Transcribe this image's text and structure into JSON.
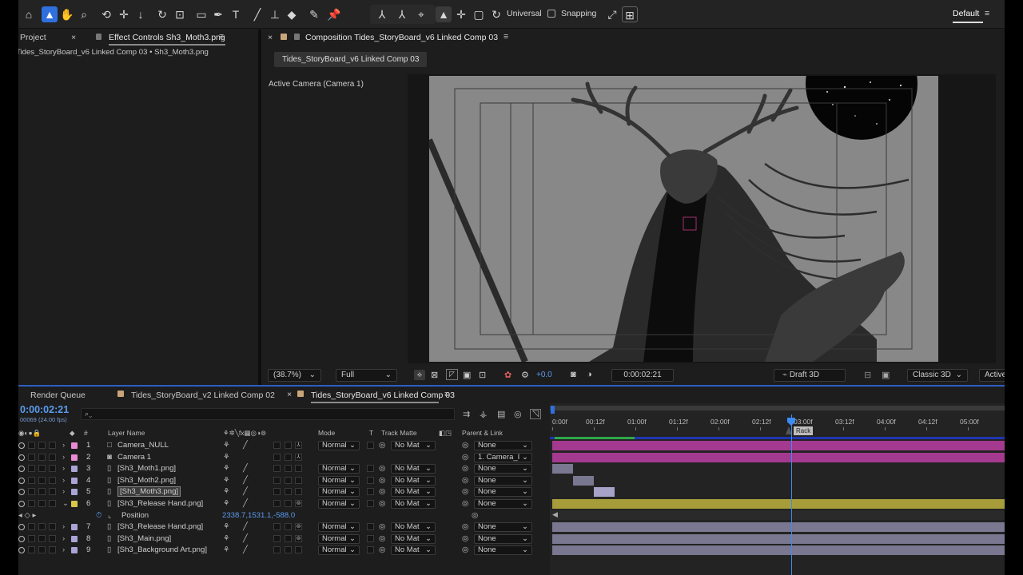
{
  "toolbar": {
    "universal_label": "Universal",
    "snapping_label": "Snapping",
    "workspace_label": "Default"
  },
  "left_panel": {
    "project_tab": "Project",
    "effect_tab": "Effect Controls Sh3_Moth3.png",
    "breadcrumb": "Tides_StoryBoard_v6 Linked Comp 03 • Sh3_Moth3.png"
  },
  "comp_panel": {
    "tab_label": "Composition Tides_StoryBoard_v6 Linked Comp 03",
    "comp_chip": "Tides_StoryBoard_v6 Linked Comp 03",
    "camera_label": "Active Camera (Camera 1)"
  },
  "viewer_status": {
    "zoom": "(38.7%)",
    "resolution": "Full",
    "exposure": "+0.0",
    "timecode": "0:00:02:21",
    "draft3d": "Draft 3D",
    "renderer": "Classic 3D",
    "active_camera": "Active Cam"
  },
  "timeline_tabs": {
    "render_queue": "Render Queue",
    "comp02": "Tides_StoryBoard_v2 Linked Comp 02",
    "comp03": "Tides_StoryBoard_v6 Linked Comp 03"
  },
  "timeline": {
    "current_time": "0:00:02:21",
    "frame_info": "00069 (24.00 fps)",
    "search_placeholder": "",
    "headers": {
      "layer_name": "Layer Name",
      "mode": "Mode",
      "t": "T",
      "track_matte": "Track Matte",
      "parent": "Parent & Link"
    },
    "ruler": [
      "0:00f",
      "00:12f",
      "01:00f",
      "01:12f",
      "02:00f",
      "02:12f",
      "03:00f",
      "03:12f",
      "04:00f",
      "04:12f",
      "05:00f"
    ],
    "marker_label": "Rack",
    "layers": [
      {
        "num": "1",
        "name": "Camera_NULL",
        "label_color": "#e78bd2",
        "mode": "Normal",
        "matte": "No Mat",
        "parent": "None",
        "type": "null"
      },
      {
        "num": "2",
        "name": "Camera 1",
        "label_color": "#e78bd2",
        "mode": "",
        "matte": "",
        "parent": "1. Camera_I",
        "type": "camera"
      },
      {
        "num": "3",
        "name": "[Sh3_Moth1.png]",
        "label_color": "#a9a4d6",
        "mode": "Normal",
        "matte": "No Mat",
        "parent": "None",
        "type": "footage"
      },
      {
        "num": "4",
        "name": "[Sh3_Moth2.png]",
        "label_color": "#a9a4d6",
        "mode": "Normal",
        "matte": "No Mat",
        "parent": "None",
        "type": "footage"
      },
      {
        "num": "5",
        "name": "[Sh3_Moth3.png]",
        "label_color": "#a9a4d6",
        "mode": "Normal",
        "matte": "No Mat",
        "parent": "None",
        "type": "footage"
      },
      {
        "num": "6",
        "name": "[Sh3_Release Hand.png]",
        "label_color": "#d6c84a",
        "mode": "Normal",
        "matte": "No Mat",
        "parent": "None",
        "type": "footage"
      },
      {
        "num": "7",
        "name": "[Sh3_Release Hand.png]",
        "label_color": "#a9a4d6",
        "mode": "Normal",
        "matte": "No Mat",
        "parent": "None",
        "type": "footage"
      },
      {
        "num": "8",
        "name": "[Sh3_Main.png]",
        "label_color": "#a9a4d6",
        "mode": "Normal",
        "matte": "No Mat",
        "parent": "None",
        "type": "footage"
      },
      {
        "num": "9",
        "name": "[Sh3_Background Art.png]",
        "label_color": "#a9a4d6",
        "mode": "Normal",
        "matte": "No Mat",
        "parent": "None",
        "type": "footage"
      }
    ],
    "property": {
      "name": "Position",
      "value": "2338.7,1531.1,-588.0"
    }
  },
  "colors": {
    "accent": "#2f6fde",
    "pink_label": "#e78bd2",
    "lavender_label": "#a9a4d6",
    "yellow_label": "#d6c84a"
  }
}
